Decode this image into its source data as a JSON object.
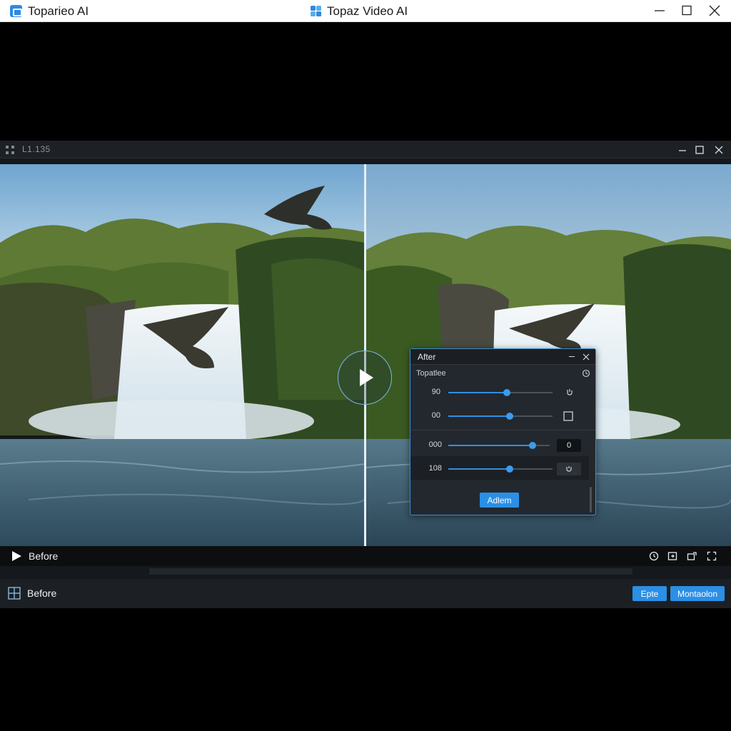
{
  "window": {
    "left_title": "Toparieo AI",
    "center_title": "Topaz Video AI"
  },
  "inner": {
    "title": "L1.135"
  },
  "panel": {
    "title": "After",
    "section_label": "Topatlee",
    "rows": [
      {
        "label": "90",
        "level": 0.56
      },
      {
        "label": "00",
        "level": 0.59
      },
      {
        "label": "000",
        "level": 0.83,
        "box": "0"
      },
      {
        "label": "108",
        "level": 0.59
      }
    ],
    "action_label": "Adlem"
  },
  "transport": {
    "label": "Before"
  },
  "footer": {
    "label": "Before",
    "buttons": [
      "Epte",
      "Montaolon"
    ]
  },
  "colors": {
    "accent": "#2a8fe5",
    "panel_border": "#3f8ccc",
    "background": "#000000"
  }
}
